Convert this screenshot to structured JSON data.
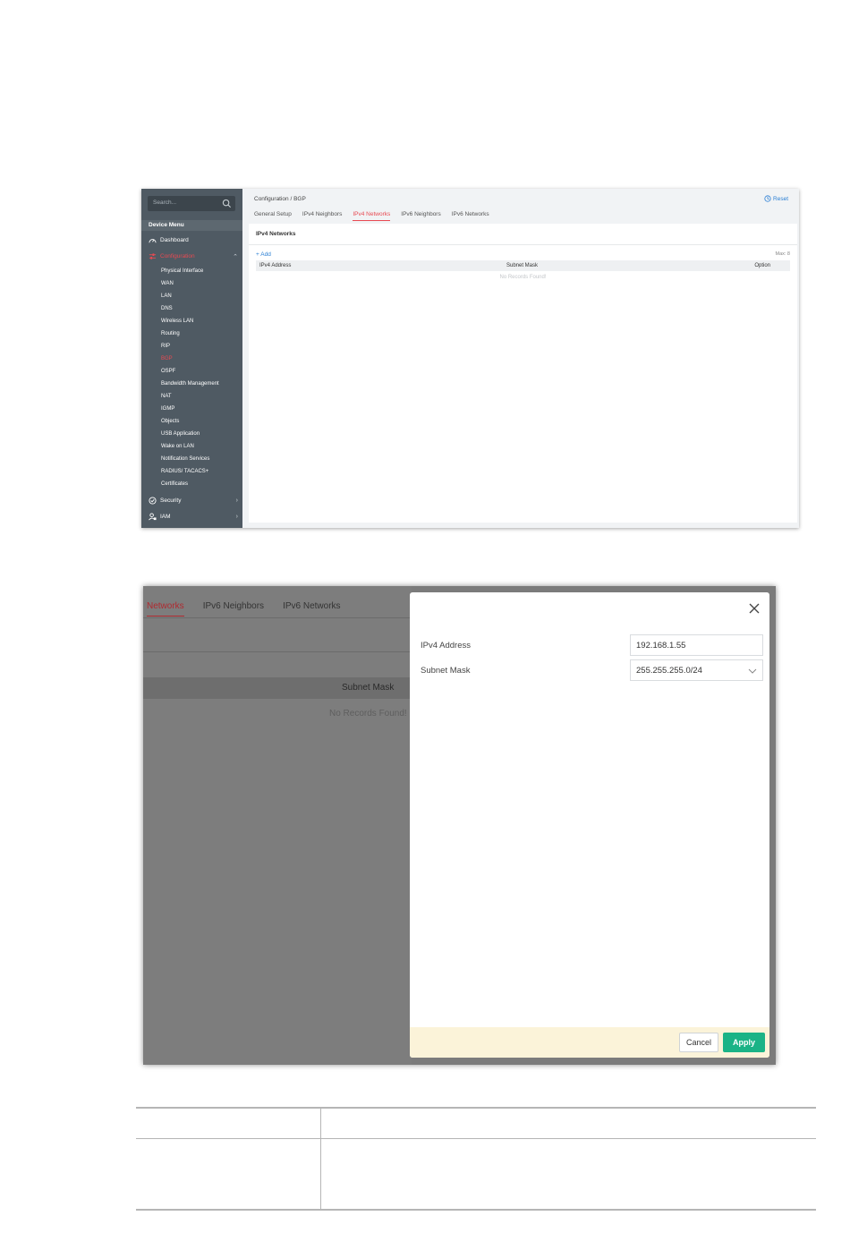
{
  "screenshot1": {
    "sidebar": {
      "search_placeholder": "Search...",
      "menu_header": "Device Menu",
      "dashboard": "Dashboard",
      "configuration": "Configuration",
      "config_items": [
        "Physical Interface",
        "WAN",
        "LAN",
        "DNS",
        "Wireless LAN",
        "Routing",
        "RIP",
        "BGP",
        "OSPF",
        "Bandwidth Management",
        "NAT",
        "IGMP",
        "Objects",
        "USB Application",
        "Wake on LAN",
        "Notification Services",
        "RADIUS/ TACACS+",
        "Certificates"
      ],
      "active_item": "BGP",
      "security": "Security",
      "iam": "IAM"
    },
    "breadcrumb": "Configuration / BGP",
    "reset": "Reset",
    "tabs": [
      "General Setup",
      "IPv4 Neighbors",
      "IPv4 Networks",
      "IPv6 Neighbors",
      "IPv6 Networks"
    ],
    "active_tab": "IPv4 Networks",
    "panel_title": "IPv4 Networks",
    "add": "+ Add",
    "max": "Max: 8",
    "columns": [
      "IPv4 Address",
      "Subnet Mask",
      "Option"
    ],
    "no_records": "No Records Found!"
  },
  "screenshot2": {
    "tabs": [
      "Networks",
      "IPv6 Neighbors",
      "IPv6 Networks"
    ],
    "subnet_header": "Subnet Mask",
    "no_records": "No Records Found!",
    "dialog": {
      "ipv4_label": "IPv4 Address",
      "ipv4_value": "192.168.1.55",
      "mask_label": "Subnet Mask",
      "mask_value": "255.255.255.0/24",
      "cancel": "Cancel",
      "apply": "Apply"
    }
  },
  "colors": {
    "accent_red": "#e84a52",
    "apply_green": "#1bb386",
    "link_blue": "#2a7fd4",
    "sidebar": "#4f5a63"
  }
}
